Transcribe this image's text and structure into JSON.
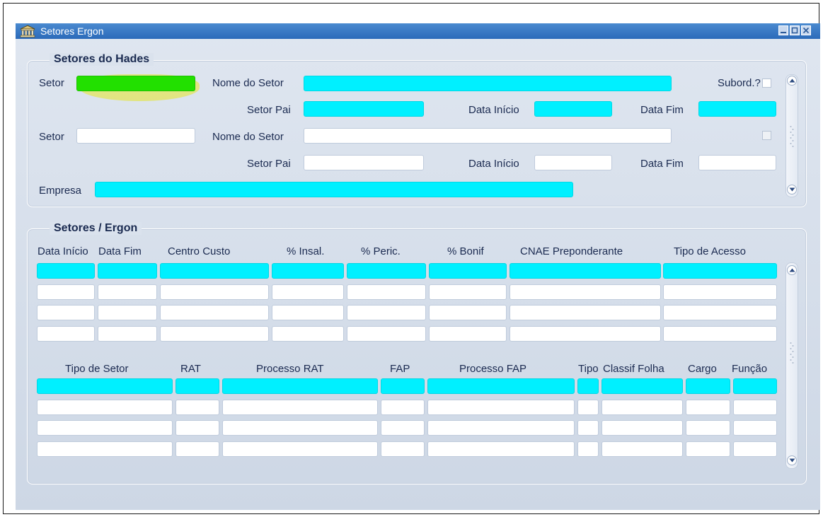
{
  "window": {
    "title": "Setores Ergon"
  },
  "hades": {
    "title": "Setores do Hades",
    "row1": {
      "setor_label": "Setor",
      "setor_value": "",
      "nome_label": "Nome do Setor",
      "nome_value": "",
      "subord_label": "Subord.?",
      "setor_pai_label": "Setor Pai",
      "setor_pai_value": "",
      "data_inicio_label": "Data Início",
      "data_inicio_value": "",
      "data_fim_label": "Data Fim",
      "data_fim_value": ""
    },
    "row2": {
      "setor_label": "Setor",
      "setor_value": "",
      "nome_label": "Nome do Setor",
      "nome_value": "",
      "setor_pai_label": "Setor Pai",
      "setor_pai_value": "",
      "data_inicio_label": "Data Início",
      "data_inicio_value": "",
      "data_fim_label": "Data Fim",
      "data_fim_value": ""
    },
    "empresa_label": "Empresa",
    "empresa_value": ""
  },
  "ergon": {
    "title": "Setores / Ergon",
    "grid1_headers": [
      "Data Início",
      "Data Fim",
      "Centro Custo",
      "% Insal.",
      "% Peric.",
      "% Bonif",
      "CNAE Preponderante",
      "Tipo de Acesso"
    ],
    "grid2_headers": [
      "Tipo de Setor",
      "RAT",
      "Processo RAT",
      "FAP",
      "Processo FAP",
      "Tipo",
      "Classif Folha",
      "Cargo",
      "Função"
    ]
  },
  "icons": {
    "app": "building-icon",
    "minimize": "minimize-icon",
    "maximize": "maximize-icon",
    "close": "close-icon",
    "scroll_up": "scroll-up-icon",
    "scroll_down": "scroll-down-icon"
  },
  "colors": {
    "titlebar": "#2b6aba",
    "required_field": "#00f0ff",
    "focused_field": "#22e000",
    "panel": "#dae2ed"
  }
}
